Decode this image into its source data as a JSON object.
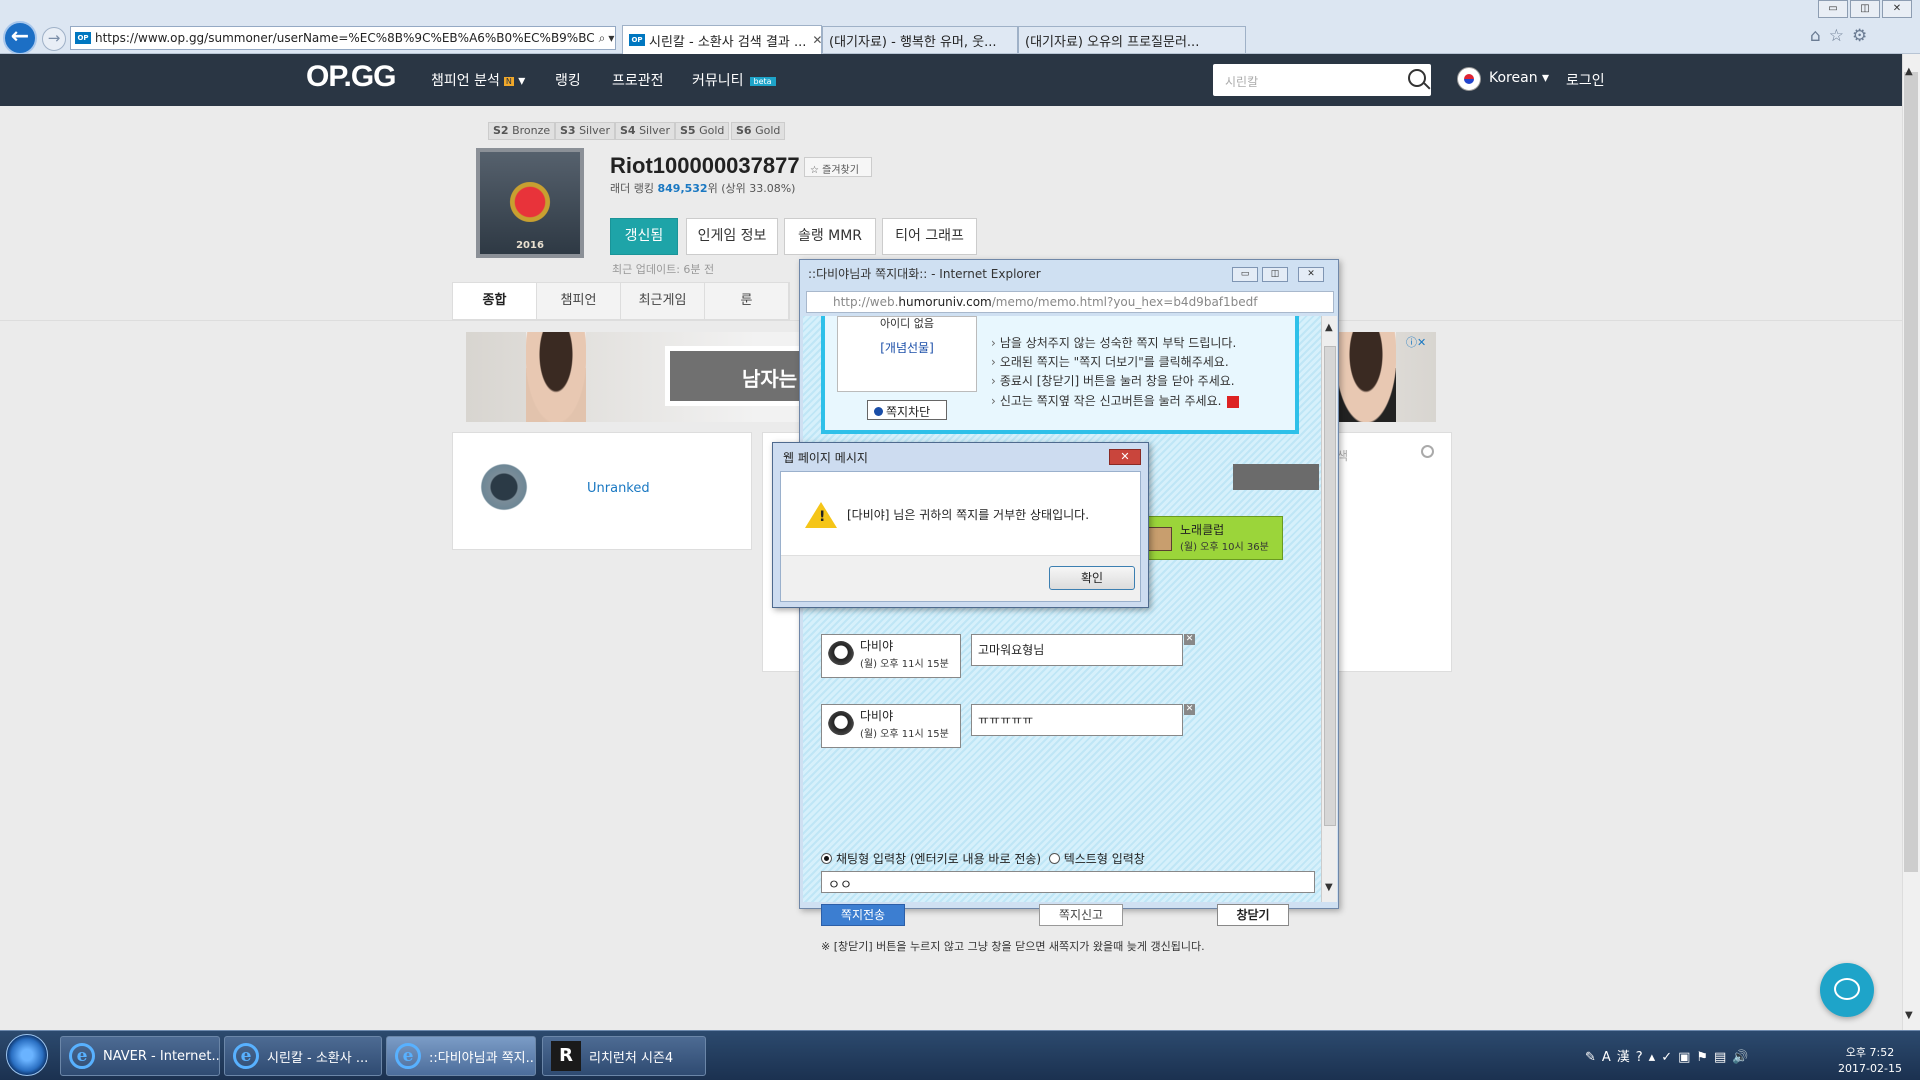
{
  "browser": {
    "url": "https://www.op.gg/summoner/userName=%EC%8B%9C%EB%A6%B0%EC%B9%BC",
    "tabs": [
      {
        "label": "시린칼 - 소환사 검색 결과 ...",
        "active": true
      },
      {
        "label": "(대기자료) - 행복한 유머, 웃..."
      },
      {
        "label": "(대기자료) 오유의 프로질문러..."
      }
    ],
    "window_controls": [
      "▭",
      "◫",
      "✕"
    ]
  },
  "opgg": {
    "logo": "OP.GG",
    "nav": [
      "챔피언 분석",
      "랭킹",
      "프로관전",
      "커뮤니티"
    ],
    "nav_badge": "N",
    "beta": "beta",
    "search_placeholder": "시린칼",
    "language": "Korean ▾",
    "login": "로그인"
  },
  "profile": {
    "seasons": [
      {
        "season": "S2",
        "tier": "Bronze"
      },
      {
        "season": "S3",
        "tier": "Silver"
      },
      {
        "season": "S4",
        "tier": "Silver"
      },
      {
        "season": "S5",
        "tier": "Gold"
      },
      {
        "season": "S6",
        "tier": "Gold"
      }
    ],
    "emblem_year": "2016",
    "name": "Riot100000037877",
    "favorite": "즐겨찾기",
    "ladder_prefix": "래더 랭킹",
    "ladder_rank": "849,532",
    "ladder_suffix": "위 (상위 33.08%)",
    "buttons": [
      "갱신됨",
      "인게임 정보",
      "솔랭 MMR",
      "티어 그래프"
    ],
    "last_update": "최근 업데이트: 6분 전",
    "subnav": [
      "종합",
      "챔피언",
      "최근게임",
      "룬"
    ],
    "rank": "Unranked",
    "search_label": "검색"
  },
  "ad": {
    "text": "남자는"
  },
  "memo": {
    "title": "::다비야님과 쪽지대화:: - Internet Explorer",
    "url_prefix": "http://web.",
    "url_domain": "humoruniv.com",
    "url_suffix": "/memo/memo.html?you_hex=b4d9baf1bedf",
    "gift_top": "아이디 없음",
    "gift_link": "[개념선물]",
    "block": "쪽지차단",
    "rules": [
      "남을 상처주지 않는 성숙한 쪽지 부탁 드립니다.",
      "오래된 쪽지는 \"쪽지 더보기\"를 클릭해주세요.",
      "종료시 [창닫기] 버튼을 눌러 창을 닫아 주세요.",
      "신고는 쪽지옆 작은 신고버튼을 눌러 주세요."
    ],
    "other": {
      "name": "노래클럽",
      "time": "(월) 오후 10시 36분"
    },
    "messages": [
      {
        "name": "다비야",
        "time": "(월) 오후 11시 15분",
        "text": "고마워요형님"
      },
      {
        "name": "다비야",
        "time": "(월) 오후 11시 15분",
        "text": "ㅠㅠㅠㅠㅠ"
      }
    ],
    "radio_chat": "채팅형 입력창 (엔터키로 내용 바로 전송)",
    "radio_text": "텍스트형 입력창",
    "input_value": "ㅇㅇ",
    "send": "쪽지전송",
    "report": "쪽지신고",
    "close": "창닫기",
    "note": "※ [창닫기] 버튼을 누르지 않고 그냥 창을 닫으면 새쪽지가 왔을때 늦게 갱신됩니다."
  },
  "alert": {
    "title": "웹 페이지 메시지",
    "message": "[다비야] 님은 귀하의 쪽지를 거부한 상태입니다.",
    "ok": "확인"
  },
  "taskbar": {
    "items": [
      "NAVER - Internet...",
      "시린칼 - 소환사 ...",
      "::다비야님과 쪽지...",
      "리치런처 시즌4"
    ],
    "time": "오후 7:52",
    "date": "2017-02-15"
  }
}
